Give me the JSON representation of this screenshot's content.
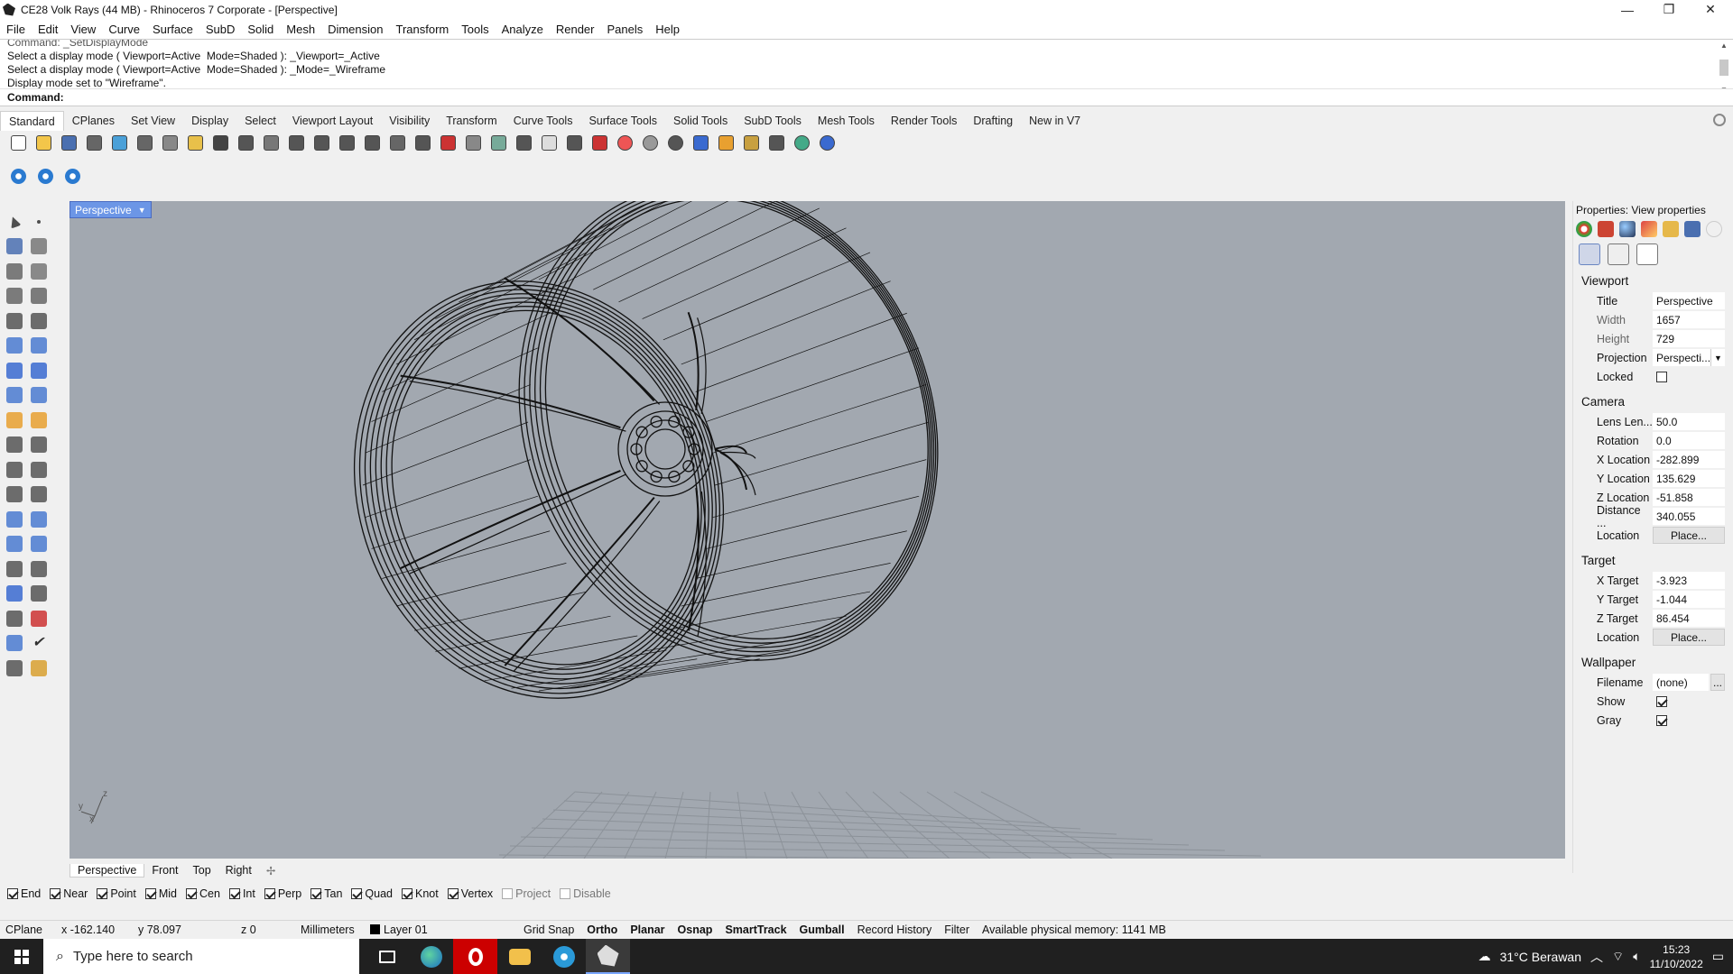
{
  "window": {
    "title": "CE28 Volk Rays (44 MB) - Rhinoceros 7 Corporate - [Perspective]",
    "minimize": "—",
    "maximize": "❐",
    "close": "✕"
  },
  "menu": [
    "File",
    "Edit",
    "View",
    "Curve",
    "Surface",
    "SubD",
    "Solid",
    "Mesh",
    "Dimension",
    "Transform",
    "Tools",
    "Analyze",
    "Render",
    "Panels",
    "Help"
  ],
  "command_history": [
    "Command: _SetDisplayMode",
    "Select a display mode ( Viewport=Active  Mode=Shaded ): _Viewport=_Active",
    "Select a display mode ( Viewport=Active  Mode=Shaded ): _Mode=_Wireframe",
    "Display mode set to \"Wireframe\"."
  ],
  "command_prompt": "Command:",
  "command_value": "",
  "toolbar_tabs": [
    "Standard",
    "CPlanes",
    "Set View",
    "Display",
    "Select",
    "Viewport Layout",
    "Visibility",
    "Transform",
    "Curve Tools",
    "Surface Tools",
    "Solid Tools",
    "SubD Tools",
    "Mesh Tools",
    "Render Tools",
    "Drafting",
    "New in V7"
  ],
  "active_tab": "Standard",
  "toolbar_icons": [
    "new-icon",
    "open-icon",
    "save-icon",
    "print-icon",
    "import-icon",
    "cut-icon",
    "copy-icon",
    "paste-icon",
    "undo-icon",
    "pan-icon",
    "rotate-view-icon",
    "zoom-dynamic-icon",
    "zoom-window-icon",
    "zoom-extents-icon",
    "zoom-selected-icon",
    "undo-view-icon",
    "four-viewports-icon",
    "car-icon",
    "properties-icon",
    "cplane-icon",
    "grid-icon",
    "light-icon",
    "lock-icon",
    "material-icon",
    "color-wheel-icon",
    "shaded-sphere-icon",
    "rendered-sphere-icon",
    "render-icon",
    "dim-icon",
    "gear-icon",
    "layout-icon",
    "globe-icon",
    "help-icon"
  ],
  "toolbar2_icons": [
    "subd-box-icon",
    "subd-sphere-icon",
    "subd-cylinder-icon"
  ],
  "left_tools": [
    "select-arrow-icon",
    "point-icon",
    "polyline-icon",
    "curve-icon",
    "circle-icon",
    "ellipse-icon",
    "polygon-icon",
    "rectangle-icon",
    "arc-icon",
    "fillet-curve-icon",
    "surface-icon",
    "surface-edge-icon",
    "box-icon",
    "boolean-icon",
    "extrude-icon",
    "solid-edit-icon",
    "mesh-icon",
    "explode-icon",
    "trim-icon",
    "split-icon",
    "group-icon",
    "ungroup-icon",
    "move-icon",
    "rotate-icon",
    "scale-icon",
    "array-icon",
    "text-icon",
    "dimension-icon",
    "block-icon",
    "layer-icon",
    "bbox-icon",
    "ruler-icon",
    "grid-array-icon",
    "gumball-icon",
    "analyze-icon",
    "checkmark-icon",
    "render-mesh-icon",
    "light-bulb-icon"
  ],
  "viewport": {
    "label": "Perspective",
    "axes": {
      "x": "x",
      "y": "y",
      "z": "z"
    }
  },
  "viewport_tabs": [
    "Perspective",
    "Front",
    "Top",
    "Right"
  ],
  "active_viewport_tab": "Perspective",
  "osnaps": [
    {
      "label": "End",
      "checked": true
    },
    {
      "label": "Near",
      "checked": true
    },
    {
      "label": "Point",
      "checked": true
    },
    {
      "label": "Mid",
      "checked": true
    },
    {
      "label": "Cen",
      "checked": true
    },
    {
      "label": "Int",
      "checked": true
    },
    {
      "label": "Perp",
      "checked": true
    },
    {
      "label": "Tan",
      "checked": true
    },
    {
      "label": "Quad",
      "checked": true
    },
    {
      "label": "Knot",
      "checked": true
    },
    {
      "label": "Vertex",
      "checked": true
    },
    {
      "label": "Project",
      "checked": false
    },
    {
      "label": "Disable",
      "checked": false
    }
  ],
  "status": {
    "cplane": "CPlane",
    "x": "x -162.140",
    "y": "y 78.097",
    "z": "z 0",
    "units": "Millimeters",
    "layer": "Layer 01",
    "toggles": [
      {
        "label": "Grid Snap",
        "on": false
      },
      {
        "label": "Ortho",
        "on": true
      },
      {
        "label": "Planar",
        "on": true
      },
      {
        "label": "Osnap",
        "on": true
      },
      {
        "label": "SmartTrack",
        "on": true
      },
      {
        "label": "Gumball",
        "on": true
      },
      {
        "label": "Record History",
        "on": false
      },
      {
        "label": "Filter",
        "on": false
      }
    ],
    "memory": "Available physical memory: 1141 MB"
  },
  "properties": {
    "header": "Properties: View properties",
    "viewport_section": "Viewport",
    "title_label": "Title",
    "title_value": "Perspective",
    "width_label": "Width",
    "width_value": "1657",
    "height_label": "Height",
    "height_value": "729",
    "projection_label": "Projection",
    "projection_value": "Perspecti...",
    "locked_label": "Locked",
    "locked": false,
    "camera_section": "Camera",
    "lens_label": "Lens Len...",
    "lens_value": "50.0",
    "rotation_label": "Rotation",
    "rotation_value": "0.0",
    "xloc_label": "X Location",
    "xloc_value": "-282.899",
    "yloc_label": "Y Location",
    "yloc_value": "135.629",
    "zloc_label": "Z Location",
    "zloc_value": "-51.858",
    "distance_label": "Distance ...",
    "distance_value": "340.055",
    "location_label": "Location",
    "place_button": "Place...",
    "target_section": "Target",
    "xt_label": "X Target",
    "xt_value": "-3.923",
    "yt_label": "Y Target",
    "yt_value": "-1.044",
    "zt_label": "Z Target",
    "zt_value": "86.454",
    "target_location_label": "Location",
    "target_place_button": "Place...",
    "wallpaper_section": "Wallpaper",
    "filename_label": "Filename",
    "filename_value": "(none)",
    "browse_button": "...",
    "show_label": "Show",
    "show": true,
    "gray_label": "Gray",
    "gray": true
  },
  "taskbar": {
    "search_placeholder": "Type here to search",
    "weather": "31°C  Berawan",
    "time": "15:23",
    "date": "11/10/2022"
  },
  "colors": {
    "viewport_bg": "#a2a8b0",
    "viewport_label_bg": "#6c96e6",
    "taskbar_bg": "#202020"
  }
}
